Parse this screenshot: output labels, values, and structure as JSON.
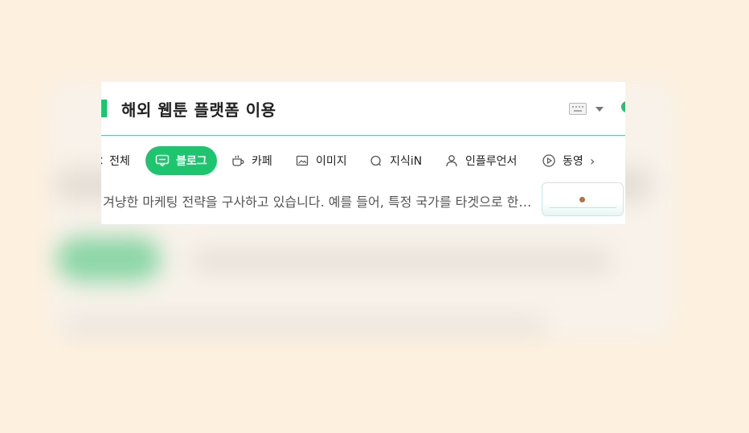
{
  "header": {
    "title": "해외 웹툰 플랫폼 이용"
  },
  "tabs": [
    {
      "label": "전체",
      "icon": "all-icon",
      "active": false
    },
    {
      "label": "블로그",
      "icon": "blog-icon",
      "active": true
    },
    {
      "label": "카페",
      "icon": "cafe-icon",
      "active": false
    },
    {
      "label": "이미지",
      "icon": "image-icon",
      "active": false
    },
    {
      "label": "지식iN",
      "icon": "knowledge-icon",
      "active": false
    },
    {
      "label": "인플루언서",
      "icon": "person-icon",
      "active": false
    },
    {
      "label": "동영",
      "icon": "video-icon",
      "active": false
    }
  ],
  "result": {
    "snippet": "겨냥한 마케팅 전략을 구사하고 있습니다. 예를 들어, 특정 국가를 타겟으로 한…"
  },
  "colors": {
    "accent": "#1ec46e",
    "background": "#fdf0de"
  }
}
